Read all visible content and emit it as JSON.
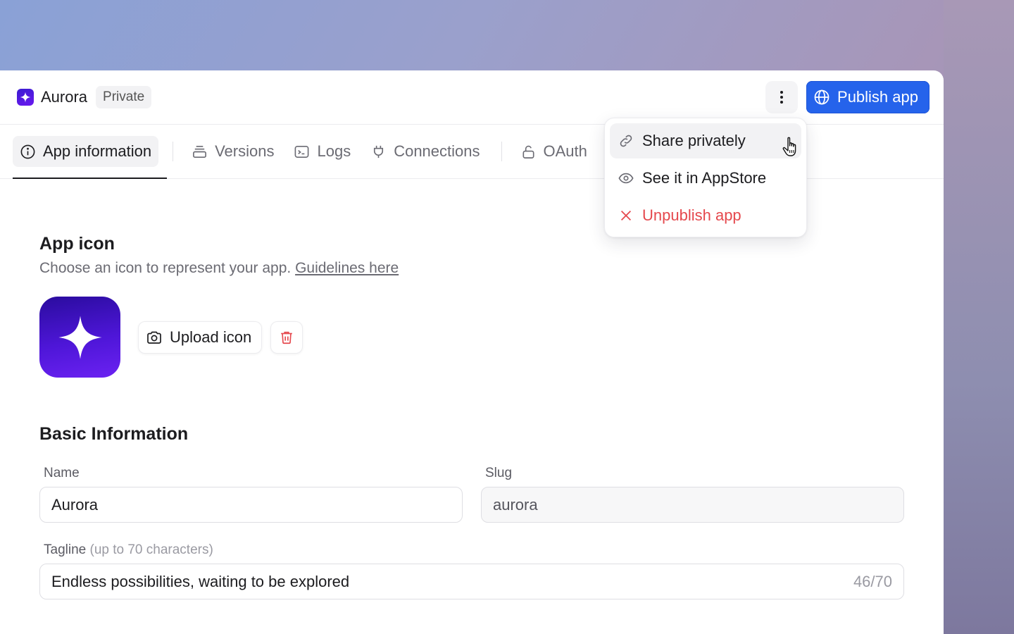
{
  "header": {
    "app_name": "Aurora",
    "visibility_badge": "Private",
    "more_icon": "more-vertical-icon",
    "publish_label": "Publish app",
    "publish_color": "#2563eb"
  },
  "tabs": [
    {
      "label": "App information",
      "icon": "info-icon",
      "active": true
    },
    {
      "label": "Versions",
      "icon": "layers-icon"
    },
    {
      "label": "Logs",
      "icon": "terminal-icon"
    },
    {
      "label": "Connections",
      "icon": "plug-icon"
    },
    {
      "label": "OAuth",
      "icon": "unlock-icon"
    }
  ],
  "menu": {
    "items": [
      {
        "label": "Share privately",
        "icon": "link-icon"
      },
      {
        "label": "See it in AppStore",
        "icon": "eye-icon"
      },
      {
        "label": "Unpublish app",
        "icon": "x-icon",
        "danger": true
      }
    ]
  },
  "app_icon_section": {
    "title": "App icon",
    "description": "Choose an icon to represent your app.",
    "guidelines_link": "Guidelines here",
    "upload_label": "Upload icon"
  },
  "basic_info": {
    "title": "Basic Information",
    "name_label": "Name",
    "name_value": "Aurora",
    "slug_label": "Slug",
    "slug_value": "aurora",
    "tagline_label": "Tagline",
    "tagline_hint": "(up to 70 characters)",
    "tagline_value": "Endless possibilities, waiting to be explored",
    "tagline_counter": "46/70"
  },
  "colors": {
    "danger": "#e5484d",
    "brand_icon": "#4e16d8"
  }
}
